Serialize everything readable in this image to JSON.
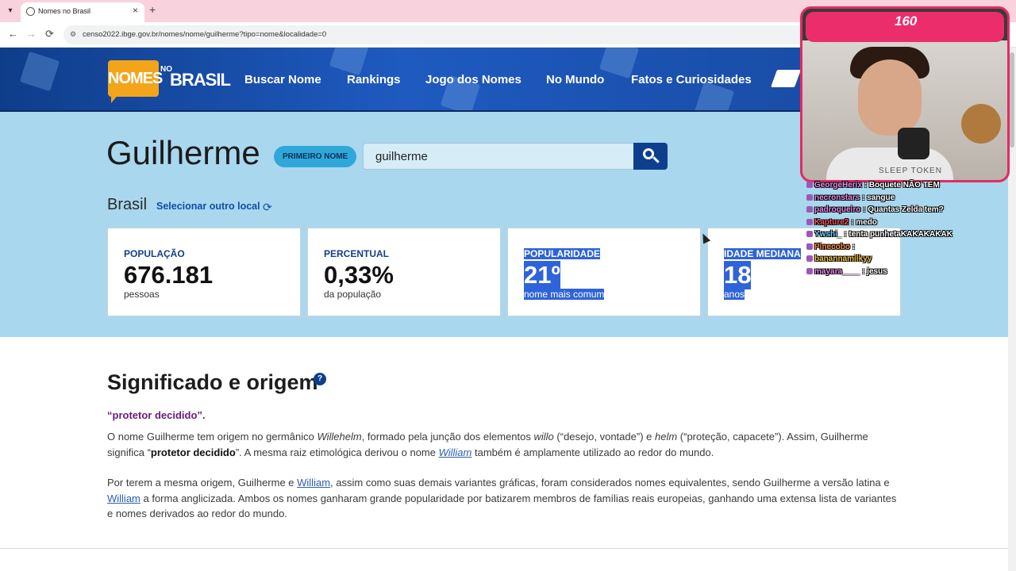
{
  "browser": {
    "tab_title": "Nomes no Brasil",
    "tab_close": "×",
    "new_tab": "+",
    "url": "censo2022.ibge.gov.br/nomes/nome/guilherme?tipo=nome&localidade=0",
    "back": "←",
    "forward": "→",
    "reload": "⟳"
  },
  "header": {
    "logo_nomes": "NOMES",
    "logo_no": "NO",
    "logo_brasil": "BRASIL",
    "menu": [
      "Buscar Nome",
      "Rankings",
      "Jogo dos Nomes",
      "No Mundo",
      "Fatos e Curiosidades"
    ]
  },
  "hero": {
    "name": "Guilherme",
    "badge": "PRIMEIRO NOME",
    "search_value": "guilherme",
    "location": "Brasil",
    "change_location": "Selecionar outro local",
    "refresh": "⟳",
    "cards": [
      {
        "label": "POPULAÇÃO",
        "value": "676.181",
        "unit": "pessoas"
      },
      {
        "label": "PERCENTUAL",
        "value": "0,33%",
        "unit": "da população"
      },
      {
        "label": "POPULARIDADE",
        "value": "21º",
        "unit": "nome mais comum"
      },
      {
        "label": "IDADE MEDIANA",
        "value": "18",
        "unit": "anos"
      }
    ]
  },
  "section": {
    "title": "Significado e origem",
    "help": "?",
    "tagline": "“protetor decidido”.",
    "p1_a": "O nome Guilherme tem origem no germânico ",
    "p1_b": "Willehelm",
    "p1_c": ", formado pela junção dos elementos ",
    "p1_d": "willo",
    "p1_e": " (“desejo, vontade”) e ",
    "p1_f": "helm",
    "p1_g": " (“proteção, capacete”). Assim, Guilherme significa “",
    "p1_h": "protetor decidido",
    "p1_i": "”. A mesma raiz etimológica derivou o nome ",
    "p1_link": "William",
    "p1_j": " também é amplamente utilizado ao redor do mundo.",
    "p2_a": "Por terem a mesma origem, Guilherme e ",
    "p2_link1": "William",
    "p2_b": ", assim como suas demais variantes gráficas, foram considerados nomes equivalentes, sendo Guilherme a versão latina e ",
    "p2_link2": "William",
    "p2_c": " a forma anglicizada. Ambos os nomes ganharam grande popularidade por batizarem membros de famílias reais europeias, ganhando uma extensa lista de variantes e nomes derivados ao redor do mundo."
  },
  "overlay": {
    "viewer_count": "160",
    "shirt_text": "SLEEP TOKEN",
    "chat": [
      {
        "nick": "GeorgeHerix",
        "msg": ": Boquete NÃO TEM"
      },
      {
        "nick": "necronstars",
        "msg": ": sangue"
      },
      {
        "nick": "padroqueiro",
        "msg": ": Quantas Zelda tem?"
      },
      {
        "nick": "Kapture2",
        "msg": ": medo"
      },
      {
        "nick": "Ywshi_",
        "msg": ": tenta punhetaKAKAKAKAK"
      },
      {
        "nick": "Pinecobo",
        "msg": ":"
      },
      {
        "nick": "banannamilkyy",
        "msg": ""
      },
      {
        "nick": "mayara____",
        "msg": ": jesus"
      }
    ]
  }
}
